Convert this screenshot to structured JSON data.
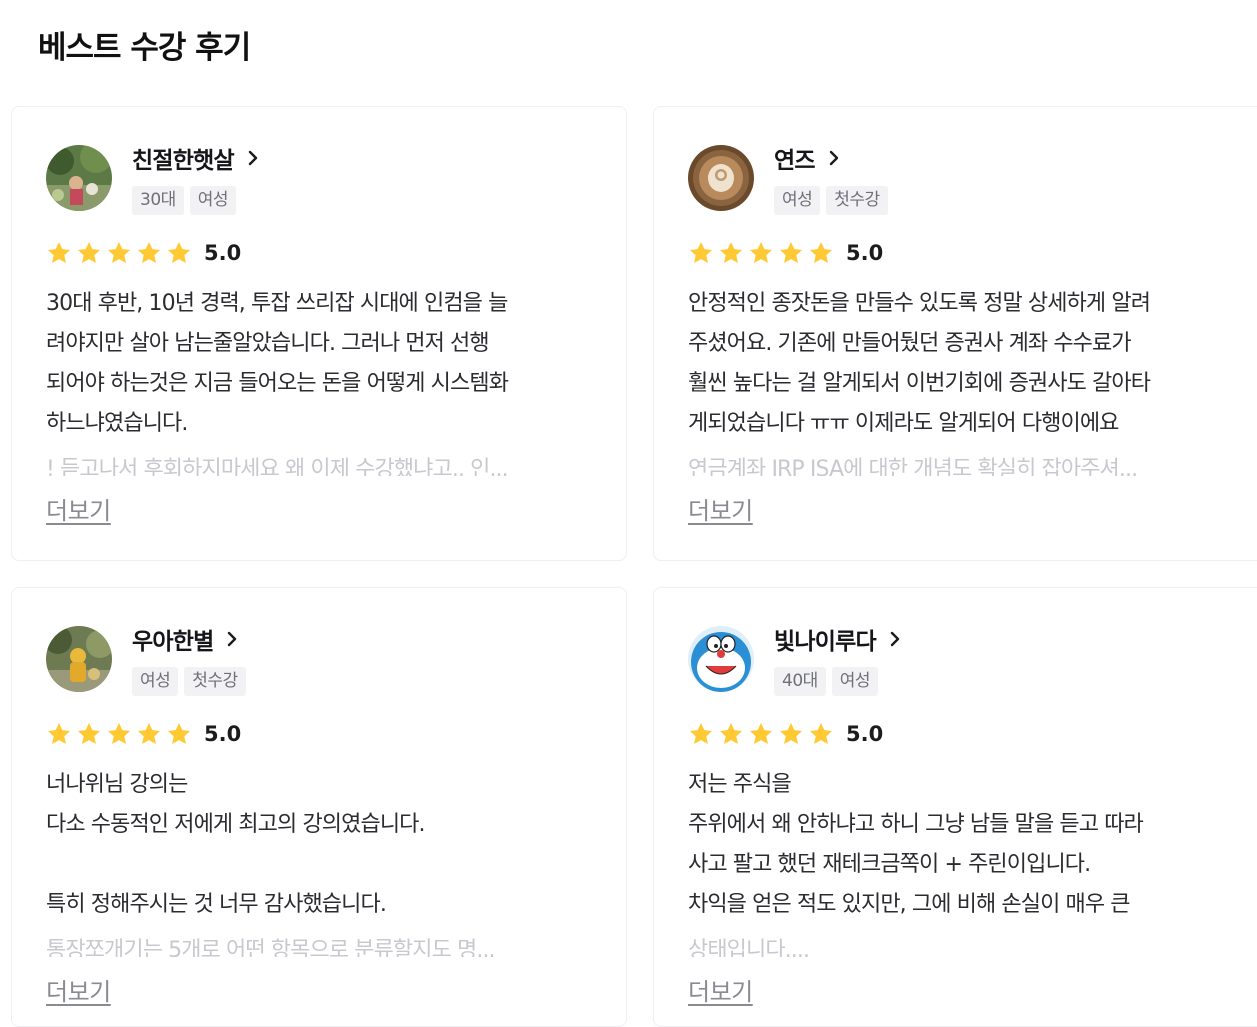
{
  "section": {
    "title": "베스트 수강 후기"
  },
  "colors": {
    "star": "#ffc934",
    "tag_bg": "#f2f2f4",
    "more_link": "#8a8b92"
  },
  "reviews": [
    {
      "nickname": "친절한햇살",
      "tags": [
        "30대",
        "여성"
      ],
      "score": "5.0",
      "stars": 5,
      "text": "30대 후반, 10년 경력, 투잡 쓰리잡 시대에 인컴을 늘\n려야지만 살아 남는줄알았습니다. 그러나 먼저 선행\n되어야 하는것은 지금 들어오는 돈을 어떻게 시스템화\n하느냐였습니다.",
      "faded": "! 듣고나서 후회하지마세요 왜 이제 수강했냐고.. 인...",
      "more": "더보기",
      "avatar_icon": "garden-photo-avatar"
    },
    {
      "nickname": "연즈",
      "tags": [
        "여성",
        "첫수강"
      ],
      "score": "5.0",
      "stars": 5,
      "text": "안정적인 종잣돈을 만들수 있도록 정말 상세하게 알려\n주셨어요. 기존에 만들어뒀던 증권사 계좌 수수료가\n훨씬 높다는 걸 알게되서 이번기회에 증권사도 갈아타\n게되었습니다 ㅠㅠ 이제라도 알게되어 다행이에요",
      "faded": "연금계좌 IRP ISA에 대한 개념도 확실히 잡아주셔...",
      "more": "더보기",
      "avatar_icon": "latte-art-avatar"
    },
    {
      "nickname": "우아한별",
      "tags": [
        "여성",
        "첫수강"
      ],
      "score": "5.0",
      "stars": 5,
      "text": "너나위님 강의는\n다소 수동적인 저에게 최고의 강의였습니다.\n\n특히 정해주시는 것 너무 감사했습니다.",
      "faded": "통장쪼개기는 5개로 어떤 항목으로 분류할지도 명...",
      "more": "더보기",
      "avatar_icon": "yellow-figure-avatar"
    },
    {
      "nickname": "빛나이루다",
      "tags": [
        "40대",
        "여성"
      ],
      "score": "5.0",
      "stars": 5,
      "text": "저는 주식을\n주위에서 왜 안하냐고 하니 그냥 남들 말을 듣고 따라\n사고 팔고 했던 재테크금쪽이 + 주린이입니다.\n차익을 얻은 적도 있지만, 그에 비해 손실이 매우 큰",
      "faded": "상태입니다....",
      "more": "더보기",
      "avatar_icon": "cartoon-cat-avatar"
    }
  ]
}
